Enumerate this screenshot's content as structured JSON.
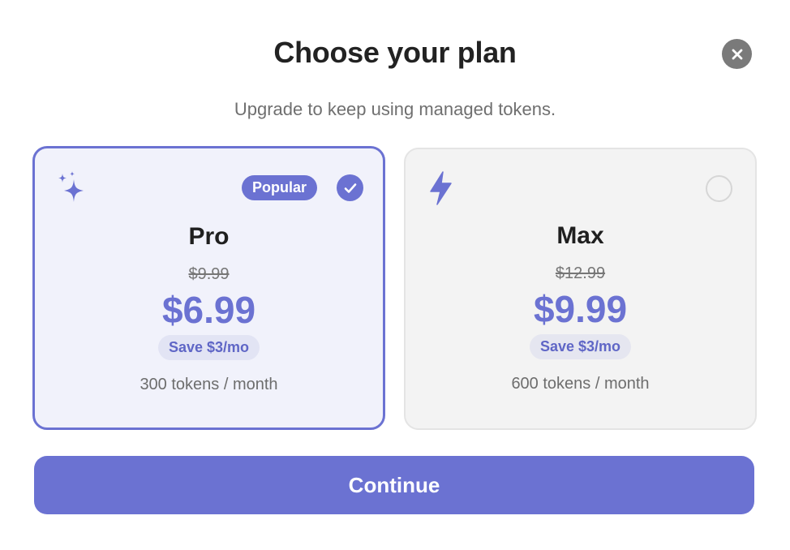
{
  "header": {
    "title": "Choose your plan",
    "subtitle": "Upgrade to keep using managed tokens."
  },
  "close": {
    "icon": "close-icon"
  },
  "plans": [
    {
      "name": "Pro",
      "icon": "sparkles-icon",
      "badge": "Popular",
      "selected": true,
      "old_price": "$9.99",
      "price": "$6.99",
      "savings": "Save $3/mo",
      "tokens": "300 tokens / month"
    },
    {
      "name": "Max",
      "icon": "lightning-icon",
      "selected": false,
      "old_price": "$12.99",
      "price": "$9.99",
      "savings": "Save $3/mo",
      "tokens": "600 tokens / month"
    }
  ],
  "footer": {
    "continue_label": "Continue"
  },
  "colors": {
    "accent": "#6b72d2",
    "selected_card_bg": "#f1f2fb",
    "unselected_card_bg": "#f3f3f3",
    "close_bg": "#7a7a7a"
  }
}
